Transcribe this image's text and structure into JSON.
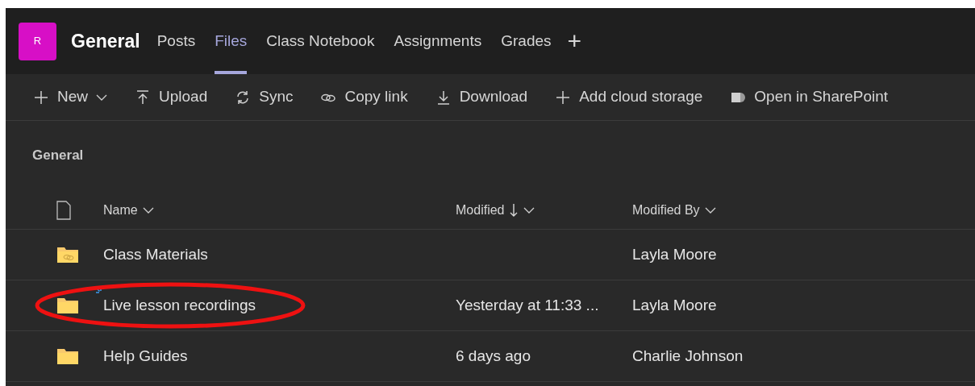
{
  "header": {
    "avatar": "R",
    "title": "General",
    "tabs": [
      {
        "label": "Posts",
        "selected": false
      },
      {
        "label": "Files",
        "selected": true
      },
      {
        "label": "Class Notebook",
        "selected": false
      },
      {
        "label": "Assignments",
        "selected": false
      },
      {
        "label": "Grades",
        "selected": false
      }
    ],
    "add_tab": "+"
  },
  "toolbar": [
    {
      "kind": "new",
      "label": "New"
    },
    {
      "kind": "upload",
      "label": "Upload"
    },
    {
      "kind": "sync",
      "label": "Sync"
    },
    {
      "kind": "link",
      "label": "Copy link"
    },
    {
      "kind": "download",
      "label": "Download"
    },
    {
      "kind": "add",
      "label": "Add cloud storage"
    },
    {
      "kind": "sharepoint",
      "label": "Open in SharePoint"
    }
  ],
  "breadcrumb": "General",
  "table": {
    "columns": [
      {
        "label": "Name",
        "sorted": false
      },
      {
        "label": "Modified",
        "sorted": true
      },
      {
        "label": "Modified By",
        "sorted": false
      }
    ],
    "rows": [
      {
        "kind": "shared",
        "name": "Class Materials",
        "modified": "",
        "modified_by": "Layla Moore",
        "is_new": false,
        "circled": false
      },
      {
        "kind": "folder",
        "name": "Live lesson recordings",
        "modified": "Yesterday at 11:33 ...",
        "modified_by": "Layla Moore",
        "is_new": true,
        "circled": true
      },
      {
        "kind": "folder",
        "name": "Help Guides",
        "modified": "6 days ago",
        "modified_by": "Charlie Johnson",
        "is_new": false,
        "circled": false
      }
    ]
  }
}
